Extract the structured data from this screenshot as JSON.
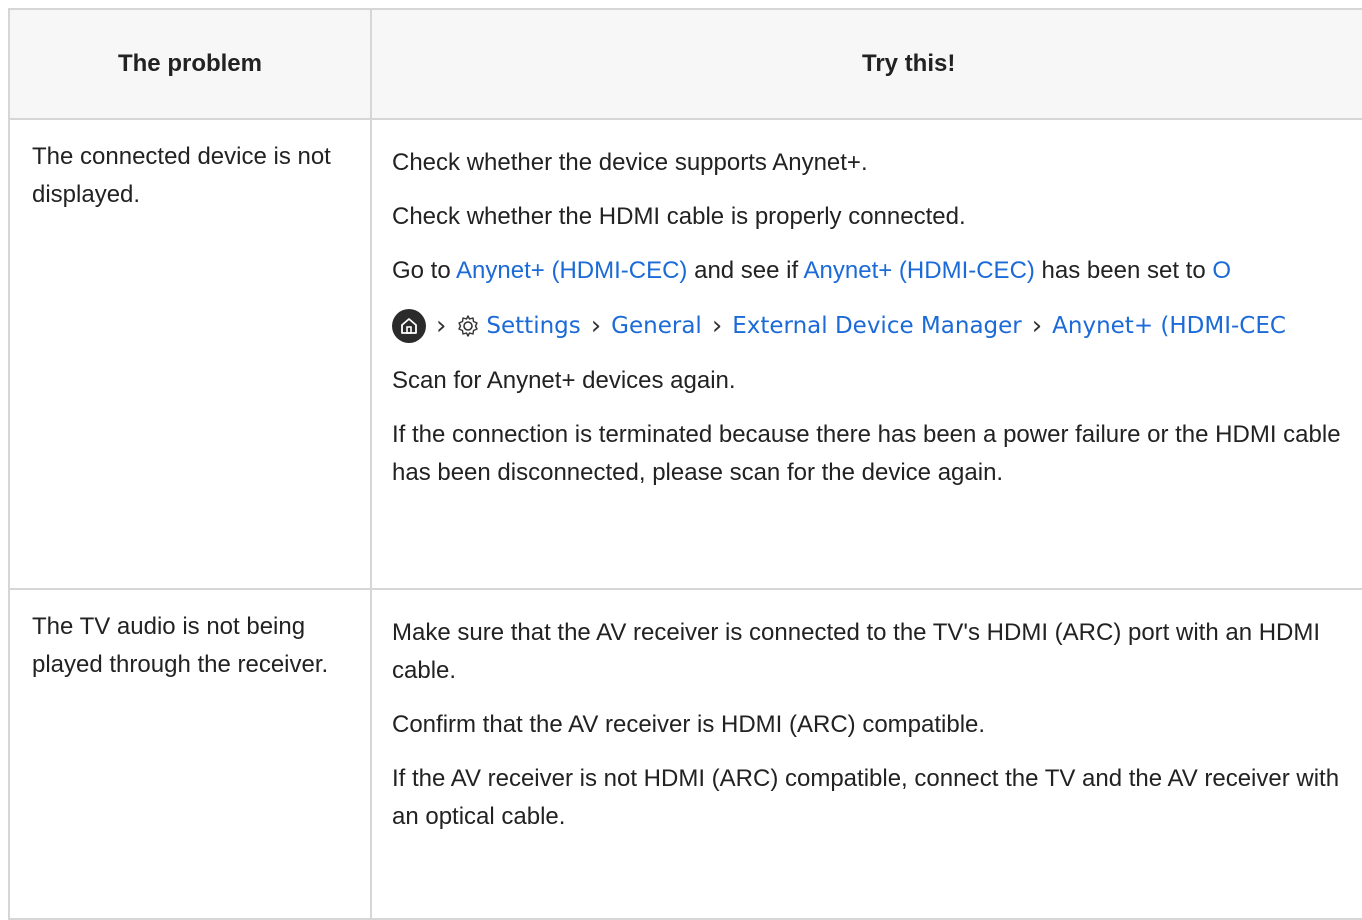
{
  "table": {
    "header": {
      "problem": "The problem",
      "solution": "Try this!"
    },
    "rows": [
      {
        "problem": "The connected device is not displayed.",
        "steps": [
          "Check whether the device supports Anynet+.",
          "Check whether the HDMI cable is properly connected."
        ],
        "goto": {
          "prefix": "Go to ",
          "link1": "Anynet+ (HDMI-CEC)",
          "middle": " and see if ",
          "link2": "Anynet+ (HDMI-CEC)",
          "suffix": " has been set to ",
          "tail": "O"
        },
        "path": [
          "Settings",
          "General",
          "External Device Manager",
          "Anynet+ (HDMI-CEC"
        ],
        "steps2": [
          "Scan for Anynet+ devices again.",
          "If the connection is terminated because there has been a power failure or the HDMI cable has been disconnected, please scan for the device again."
        ]
      },
      {
        "problem": "The TV audio is not being played through the receiver.",
        "steps": [
          "Make sure that the AV receiver is connected to the TV's HDMI (ARC) port with an HDMI cable.",
          "Confirm that the AV receiver is HDMI (ARC) compatible.",
          "If the AV receiver is not HDMI (ARC) compatible, connect the TV and the AV receiver with an optical cable."
        ]
      }
    ]
  },
  "icons": {
    "home": "home-icon",
    "gear": "gear-icon",
    "chevron": "chevron-right-icon"
  },
  "colors": {
    "link": "#1b6ad7",
    "border": "#d6d6d6",
    "header_bg": "#f7f7f7"
  }
}
